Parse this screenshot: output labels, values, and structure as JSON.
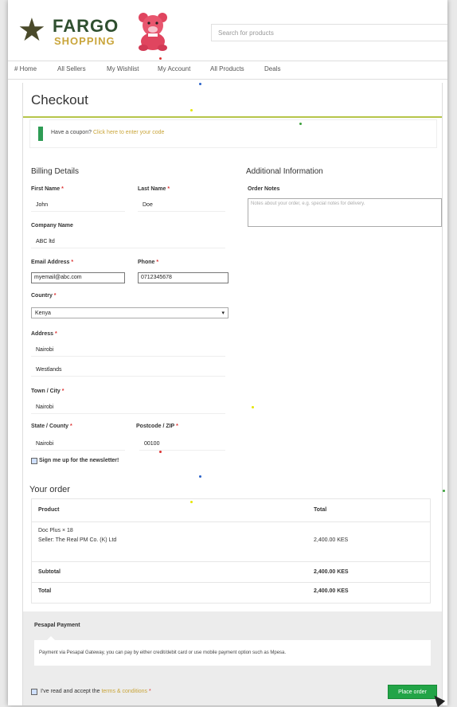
{
  "header": {
    "logo_text_1": "FARGO",
    "logo_text_2": "SHOPPING",
    "search_placeholder": "Search for products"
  },
  "nav": {
    "items": [
      "# Home",
      "All Sellers",
      "My Wishlist",
      "My Account",
      "All Products",
      "Deals"
    ]
  },
  "page": {
    "title": "Checkout"
  },
  "coupon": {
    "text": "Have a coupon?",
    "link": "Click here to enter your code"
  },
  "billing": {
    "heading": "Billing Details",
    "first_name_label": "First Name",
    "first_name": "John",
    "last_name_label": "Last Name",
    "last_name": "Doe",
    "company_label": "Company Name",
    "company": "ABC ltd",
    "email_label": "Email Address",
    "email": "myemail@abc.com",
    "phone_label": "Phone",
    "phone": "0712345678",
    "country_label": "Country",
    "country": "Kenya",
    "address_label": "Address",
    "address_1": "Nairobi",
    "address_2": "Westlands",
    "town_label": "Town / City",
    "town": "Nairobi",
    "state_label": "State / County",
    "state": "Nairobi",
    "postcode_label": "Postcode / ZIP",
    "postcode": "00100",
    "newsletter_label": "Sign me up for the newsletter!",
    "required_mark": "*"
  },
  "additional": {
    "heading": "Additional Information",
    "notes_label": "Order Notes",
    "notes_placeholder": "Notes about your order, e.g. special notes for delivery."
  },
  "order": {
    "heading": "Your order",
    "col_product": "Product",
    "col_total": "Total",
    "item_name": "Doc Plus × 18",
    "item_seller": "Seller: The Real PM Co. (K) Ltd",
    "item_total": "2,400.00 KES",
    "subtotal_label": "Subtotal",
    "subtotal": "2,400.00 KES",
    "total_label": "Total",
    "total": "2,400.00 KES"
  },
  "payment": {
    "title": "Pesapal Payment",
    "description": "Payment via Pesapal Gateway, you can pay by either credit/debit card or use mobile payment option such as Mpesa.",
    "terms_text": "I've read and accept the",
    "terms_link": "terms & conditions",
    "terms_required": "*",
    "place_order": "Place order"
  },
  "colors": {
    "accent": "#c9a53a",
    "green": "#22a447",
    "rule": "#b6c54a"
  }
}
